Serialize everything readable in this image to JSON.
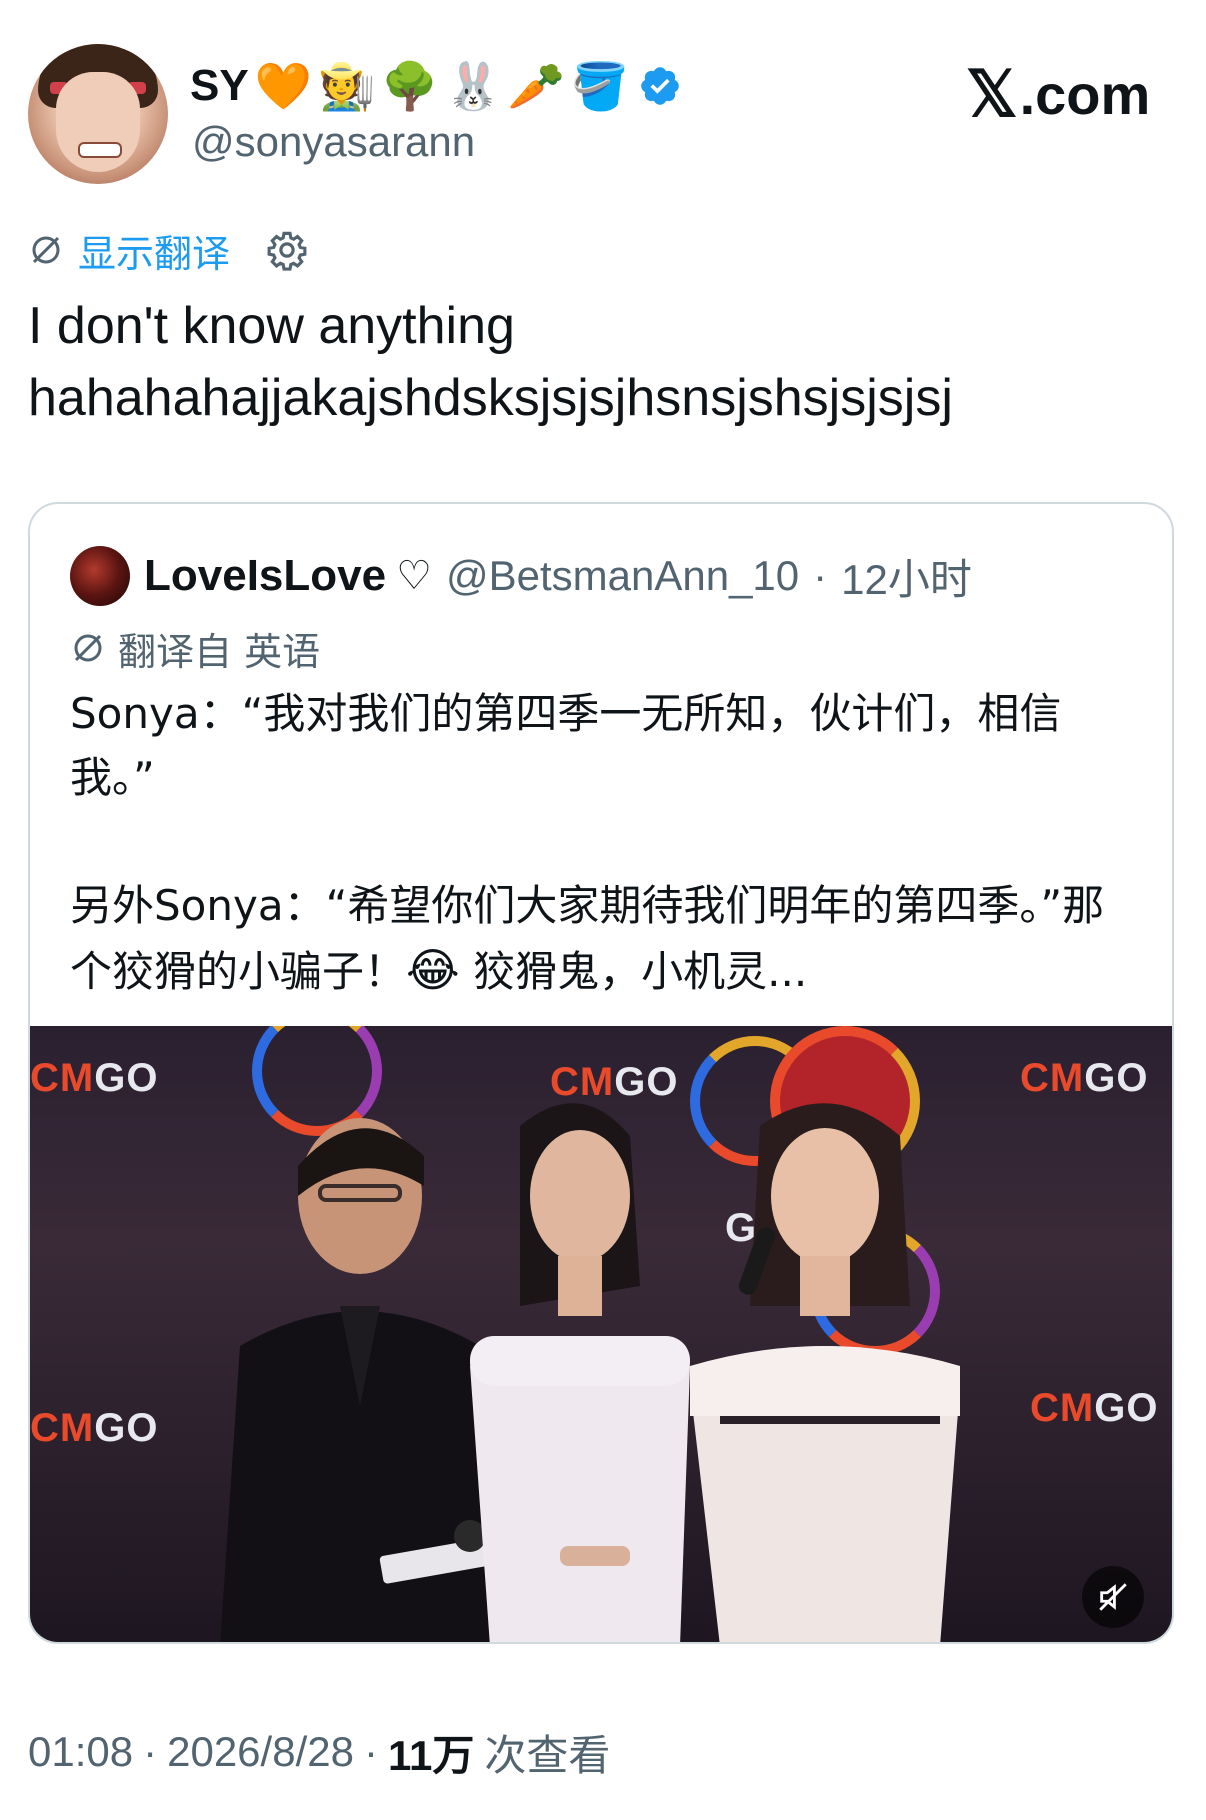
{
  "author": {
    "display_name": "SY",
    "name_emojis": [
      "🧡",
      "🧑‍🌾",
      "🌳",
      "🐰",
      "🥕",
      "🪣"
    ],
    "verified": true,
    "handle": "@sonyasarann"
  },
  "site_label": {
    "x": "𝕏",
    "rest": ".com"
  },
  "translate": {
    "link_label": "显示翻译"
  },
  "tweet": {
    "text": "I don't know anything\nhahahahajjakajshdsksjsjsjhsnsjshsjsjsjsj"
  },
  "quote": {
    "name": "LoveIsLove",
    "heart": "♡",
    "handle": "@BetsmanAnn_10",
    "separator": "·",
    "time": "12小时",
    "translate_label": "翻译自 英语",
    "para1": "Sonya：“我对我们的第四季一无所知，伙计们，相信我。”",
    "para2_before": "另外Sonya：“希望你们大家期待我们明年的第四季。”那个狡猾的小骗子！",
    "para2_emoji": "😂",
    "para2_after": " 狡猾鬼，小机灵...",
    "video": {
      "logo_cm": "CM",
      "logo_go": "GO",
      "muted": true
    }
  },
  "meta": {
    "time": "01:08",
    "sep1": "·",
    "date": "2026/8/28",
    "sep2": "·",
    "views_num": "11万",
    "views_label": "次查看"
  },
  "colors": {
    "accent": "#1d9bf0",
    "secondary_text": "#536471",
    "primary_text": "#0f1419",
    "border": "#cfd9de"
  }
}
